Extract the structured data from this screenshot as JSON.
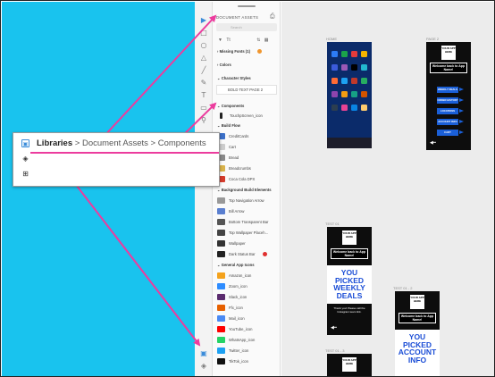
{
  "callout": {
    "segment1": "Libraries",
    "sep1": " > ",
    "segment2": "Document Assets",
    "sep2": " > ",
    "segment3": "Components"
  },
  "panel": {
    "header": "DOCUMENT ASSETS",
    "search_placeholder": "Search",
    "missing_fonts": "Missing Fonts (1)",
    "colors": "Colors",
    "character_styles": "Character Styles",
    "char_style_item": "BOLD TEXT PAGE 2",
    "components": "Components",
    "top_item": "TouchpScreen_icon",
    "items": [
      "Build Flow",
      "CreditCards",
      "Cart",
      "Bread",
      "Breadcrumbs",
      "Coca Cola DPX",
      "Background Build Elements",
      "Top Navigation Arrow",
      "Bill Arrow",
      "Bottom Transparent Bar",
      "Top Wallpaper Placeh...",
      "Wallpaper",
      "Dark Status Bar",
      "General App Icons",
      "Amazon_icon",
      "Zoom_icon",
      "Slack_icon",
      "Ffx_icon",
      "Mail_icon",
      "YouTube_icon",
      "WhatsApp_icon",
      "Twitter_icon",
      "TikTok_icon"
    ]
  },
  "canvas": {
    "home_label": "HOME",
    "page2_label": "PAGE 2",
    "test1_label": "TEST 01",
    "test2_label": "TEST 01 - 2",
    "test3_label": "TEST 01 - 3",
    "logo_text": "YOUR APP HERE",
    "welcome_text": "Welcome back to App Name!",
    "promo1": "YOU PICKED WEEKLY DEALS",
    "promo2": "YOU PICKED ACCOUNT INFO",
    "thanks_text": "Thank you! Please call the Instagram team link.",
    "menu_items": [
      "WEEKLY DEALS",
      "ORDER HISTORY",
      "LOCATIONS",
      "ACCOUNT INFO",
      "CART"
    ]
  },
  "colors": {
    "accent_pink": "#ec3c9e",
    "cyan_bg": "#19c3ee",
    "promo_blue": "#1a4dd6"
  }
}
